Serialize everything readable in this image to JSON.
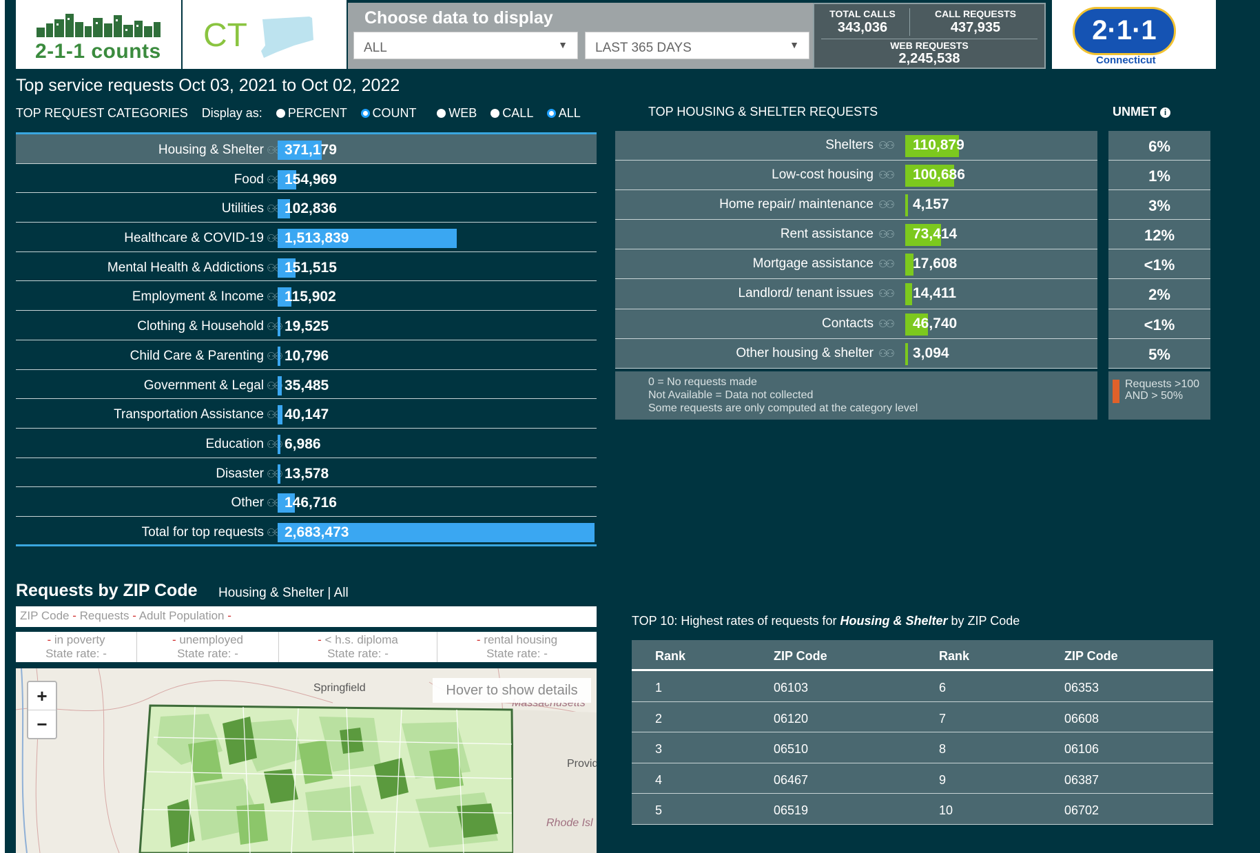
{
  "header": {
    "brand_name": "2-1-1 counts",
    "state_abbr": "CT",
    "choose_title": "Choose data to display",
    "filter_category": "ALL",
    "filter_period": "LAST 365 DAYS",
    "stats": {
      "total_calls_label": "TOTAL CALLS",
      "total_calls_value": "343,036",
      "call_requests_label": "CALL REQUESTS",
      "call_requests_value": "437,935",
      "web_requests_label": "WEB REQUESTS",
      "web_requests_value": "2,245,538"
    },
    "partner_logo_text": "2·1·1",
    "partner_logo_sub": "Connecticut"
  },
  "main_title": "Top service requests Oct 03, 2021 to Oct 02, 2022",
  "controls": {
    "section_label": "TOP REQUEST CATEGORIES",
    "display_as_label": "Display as:",
    "percent_label": "PERCENT",
    "count_label": "COUNT",
    "web_label": "WEB",
    "call_label": "CALL",
    "all_label": "ALL",
    "selected_display": "COUNT",
    "selected_channel": "ALL"
  },
  "categories": [
    {
      "label": "Housing & Shelter",
      "value": "371,179",
      "count": 371179
    },
    {
      "label": "Food",
      "value": "154,969",
      "count": 154969
    },
    {
      "label": "Utilities",
      "value": "102,836",
      "count": 102836
    },
    {
      "label": "Healthcare & COVID-19",
      "value": "1,513,839",
      "count": 1513839
    },
    {
      "label": "Mental Health & Addictions",
      "value": "151,515",
      "count": 151515
    },
    {
      "label": "Employment & Income",
      "value": "115,902",
      "count": 115902
    },
    {
      "label": "Clothing & Household",
      "value": "19,525",
      "count": 19525
    },
    {
      "label": "Child Care & Parenting",
      "value": "10,796",
      "count": 10796
    },
    {
      "label": "Government & Legal",
      "value": "35,485",
      "count": 35485
    },
    {
      "label": "Transportation Assistance",
      "value": "40,147",
      "count": 40147
    },
    {
      "label": "Education",
      "value": "6,986",
      "count": 6986
    },
    {
      "label": "Disaster",
      "value": "13,578",
      "count": 13578
    },
    {
      "label": "Other",
      "value": "146,716",
      "count": 146716
    },
    {
      "label": "Total for top requests",
      "value": "2,683,473",
      "count": 2683473
    }
  ],
  "housing": {
    "title": "TOP HOUSING & SHELTER REQUESTS",
    "unmet_title": "UNMET",
    "rows": [
      {
        "label": "Shelters",
        "value": "110,879",
        "count": 110879,
        "unmet": "6%"
      },
      {
        "label": "Low-cost housing",
        "value": "100,686",
        "count": 100686,
        "unmet": "1%"
      },
      {
        "label": "Home repair/ maintenance",
        "value": "4,157",
        "count": 4157,
        "unmet": "3%"
      },
      {
        "label": "Rent assistance",
        "value": "73,414",
        "count": 73414,
        "unmet": "12%"
      },
      {
        "label": "Mortgage assistance",
        "value": "17,608",
        "count": 17608,
        "unmet": "<1%"
      },
      {
        "label": "Landlord/ tenant issues",
        "value": "14,411",
        "count": 14411,
        "unmet": "2%"
      },
      {
        "label": "Contacts",
        "value": "46,740",
        "count": 46740,
        "unmet": "<1%"
      },
      {
        "label": "Other housing & shelter",
        "value": "3,094",
        "count": 3094,
        "unmet": "5%"
      }
    ],
    "notes": [
      "0 = No requests made",
      "Not Available = Data not collected",
      "Some requests are only computed at the category level"
    ],
    "unmet_legend_line1": "Requests >100",
    "unmet_legend_line2": "AND > 50%",
    "unmet_legend_color": "#e0612a"
  },
  "zip": {
    "title": "Requests by ZIP Code",
    "subtitle": "Housing & Shelter | All",
    "bar_zip": "ZIP Code",
    "bar_requests": "Requests",
    "bar_adult_pop": "Adult Population",
    "dash": "-",
    "demographics": [
      {
        "label": "in poverty",
        "state_rate": "State rate: -"
      },
      {
        "label": "unemployed",
        "state_rate": "State rate: -"
      },
      {
        "label": "< h.s. diploma",
        "state_rate": "State rate: -"
      },
      {
        "label": "rental housing",
        "state_rate": "State rate: -"
      }
    ],
    "map": {
      "zoom_in": "+",
      "zoom_out": "−",
      "hover_hint": "Hover to show details",
      "label_springfield": "Springfield",
      "label_massachusetts": "Massachusetts",
      "label_providence": "Provid",
      "label_rhode_island": "Rhode Isl"
    }
  },
  "top10": {
    "title_prefix": "TOP 10: Highest rates of requests for",
    "title_category": "Housing & Shelter",
    "title_suffix": "by ZIP Code",
    "col_rank": "Rank",
    "col_zip": "ZIP Code",
    "rows": [
      {
        "rank1": "1",
        "zip1": "06103",
        "rank2": "6",
        "zip2": "06353"
      },
      {
        "rank1": "2",
        "zip1": "06120",
        "rank2": "7",
        "zip2": "06608"
      },
      {
        "rank1": "3",
        "zip1": "06510",
        "rank2": "8",
        "zip2": "06106"
      },
      {
        "rank1": "4",
        "zip1": "06467",
        "rank2": "9",
        "zip2": "06387"
      },
      {
        "rank1": "5",
        "zip1": "06519",
        "rank2": "10",
        "zip2": "06702"
      }
    ]
  },
  "colors": {
    "background": "#003440",
    "category_bar": "#3aa7f2",
    "housing_bar": "#7cc91e",
    "panel": "#4a6870"
  }
}
